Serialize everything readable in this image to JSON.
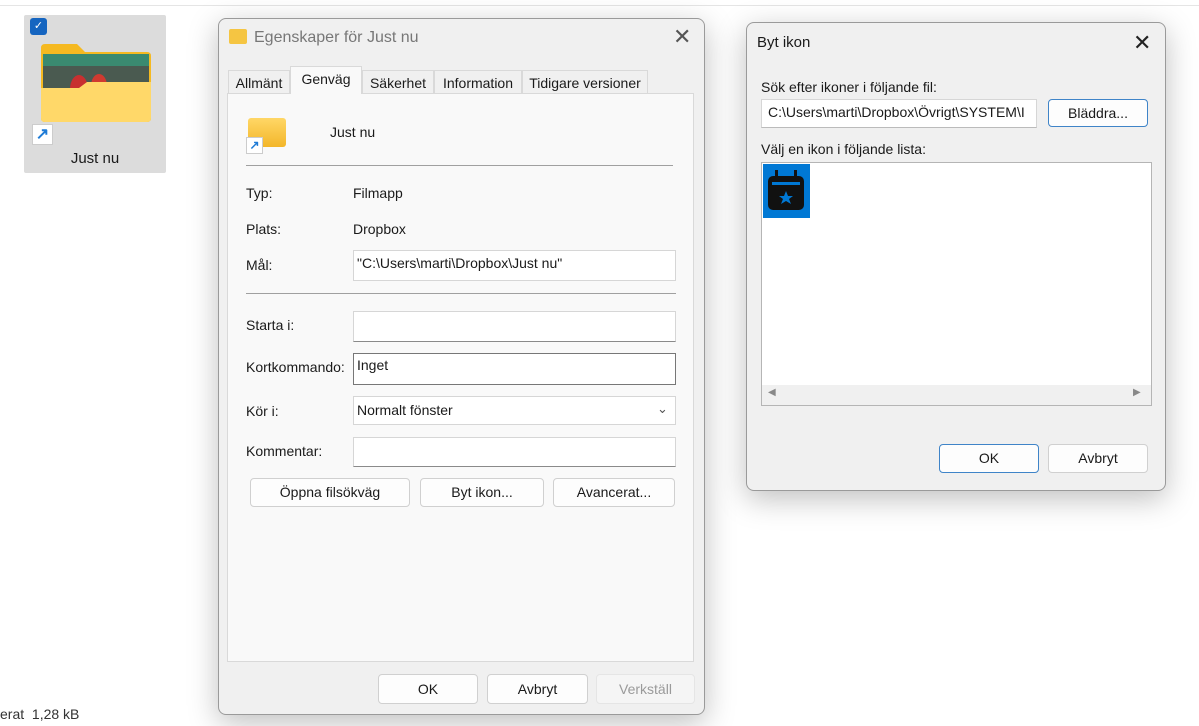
{
  "desktop": {
    "item_label": "Just nu",
    "status_text": "erat  1,28 kB"
  },
  "properties": {
    "title": "Egenskaper för Just nu",
    "tabs": [
      {
        "label": "Allmänt"
      },
      {
        "label": "Genväg",
        "active": true
      },
      {
        "label": "Säkerhet"
      },
      {
        "label": "Information"
      },
      {
        "label": "Tidigare versioner"
      }
    ],
    "name": "Just nu",
    "type_label": "Typ:",
    "type_value": "Filmapp",
    "location_label": "Plats:",
    "location_value": "Dropbox",
    "target_label": "Mål:",
    "target_value": "\"C:\\Users\\marti\\Dropbox\\Just nu\"",
    "start_label": "Starta i:",
    "start_value": "",
    "shortcut_label": "Kortkommando:",
    "shortcut_value": "Inget",
    "run_label": "Kör i:",
    "run_value": "Normalt fönster",
    "comment_label": "Kommentar:",
    "comment_value": "",
    "open_location": "Öppna filsökväg",
    "change_icon": "Byt ikon...",
    "advanced": "Avancerat...",
    "ok": "OK",
    "cancel": "Avbryt",
    "apply": "Verkställ"
  },
  "change_icon_dialog": {
    "title": "Byt ikon",
    "file_label": "Sök efter ikoner i följande fil:",
    "file_value": "C:\\Users\\marti\\Dropbox\\Övrigt\\SYSTEM\\I",
    "browse": "Bläddra...",
    "list_label": "Välj en ikon i följande lista:",
    "icons": [
      {
        "name": "calendar-star-icon",
        "selected": true
      }
    ],
    "ok": "OK",
    "cancel": "Avbryt",
    "accent": "#0078d4"
  }
}
